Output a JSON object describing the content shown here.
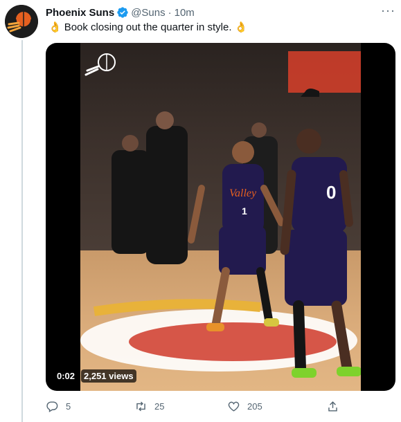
{
  "tweet": {
    "author_name": "Phoenix Suns",
    "handle": "@Suns",
    "separator": "·",
    "time": "10m",
    "more_label": "···",
    "emoji_left": "👌",
    "text": "Book closing out the quarter in style.",
    "emoji_right": "👌"
  },
  "media": {
    "duration": "0:02",
    "views": "2,251 views",
    "jersey_number_left": "1",
    "jersey_number_right": "0",
    "jersey_text_left": "Valley"
  },
  "actions": {
    "replies": "5",
    "retweets": "25",
    "likes": "205"
  },
  "icons": {
    "verified": "verified-badge-icon",
    "reply": "reply-icon",
    "retweet": "retweet-icon",
    "like": "heart-icon",
    "share": "share-icon",
    "more": "more-icon"
  },
  "colors": {
    "verified_blue": "#1d9bf0",
    "secondary_text": "#536471",
    "suns_orange": "#e56020",
    "suns_purple": "#1d1160"
  }
}
